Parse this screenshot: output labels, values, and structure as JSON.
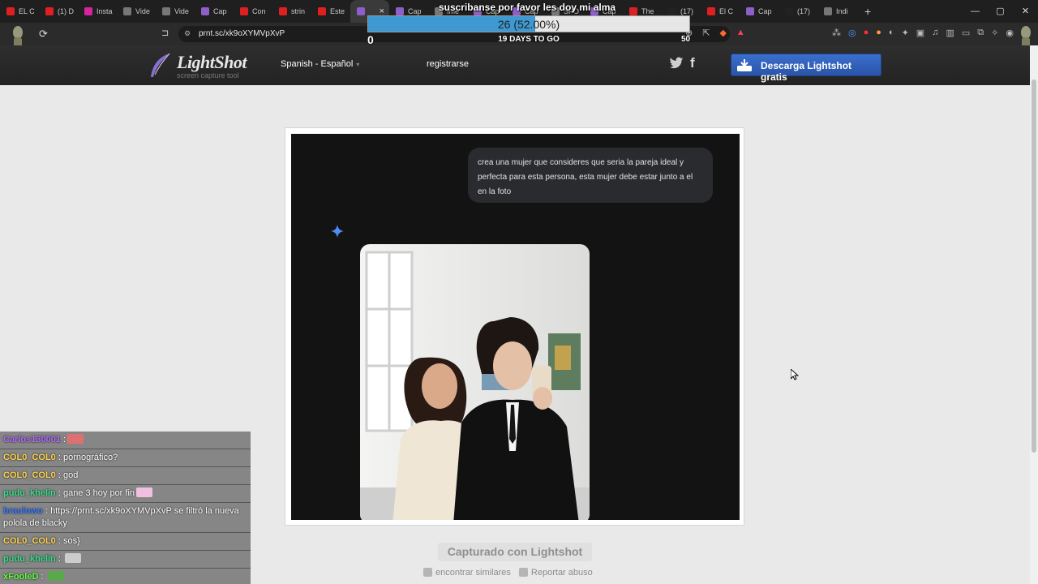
{
  "browser": {
    "tabs": [
      {
        "label": "EL C",
        "color": "#e02020"
      },
      {
        "label": "(1) D",
        "color": "#e02020"
      },
      {
        "label": "Insta",
        "color": "#d6249f"
      },
      {
        "label": "Vide",
        "color": "#777777"
      },
      {
        "label": "Vide",
        "color": "#777777"
      },
      {
        "label": "Cap",
        "color": "#8e5ec9"
      },
      {
        "label": "Con",
        "color": "#e02020"
      },
      {
        "label": "strin",
        "color": "#e02020"
      },
      {
        "label": "Este",
        "color": "#e02020"
      },
      {
        "label": "",
        "color": "#8e5ec9",
        "active": true
      },
      {
        "label": "Cap",
        "color": "#8e5ec9"
      },
      {
        "label": "Ime",
        "color": "#777777"
      },
      {
        "label": "Cap",
        "color": "#8e5ec9"
      },
      {
        "label": "Cap",
        "color": "#8e5ec9"
      },
      {
        "label": "SPO",
        "color": "#777777"
      },
      {
        "label": "Cap",
        "color": "#8e5ec9"
      },
      {
        "label": "The",
        "color": "#e02020"
      },
      {
        "label": "(17)",
        "color": "#222222"
      },
      {
        "label": "El C",
        "color": "#e02020"
      },
      {
        "label": "Cap",
        "color": "#8e5ec9"
      },
      {
        "label": "(17)",
        "color": "#222222"
      },
      {
        "label": "Indi",
        "color": "#777777"
      }
    ],
    "active_tab_close": "×",
    "new_tab": "+",
    "window_controls": {
      "minimize": "—",
      "maximize": "▢",
      "close": "✕"
    },
    "url": "prnt.sc/xk9oXYMVpXvP",
    "reload_icon": "⟳",
    "bookmark_icon": "⊐"
  },
  "stream_overlay": {
    "goal_title": "suscribanse por favor les doy mi alma",
    "goal_progress_text": "26 (52.00%)",
    "goal_fraction": 0.52,
    "goal_min": "0",
    "goal_days": "19 DAYS TO GO",
    "goal_max": "50"
  },
  "lightshot": {
    "logo_name": "LightShot",
    "logo_sub": "screen capture tool",
    "language": "Spanish - Español",
    "register": "registrarse",
    "download_button": "Descarga Lightshot gratis",
    "caption": "Capturado con Lightshot",
    "find_similar": "encontrar similares",
    "report_abuse": "Reportar abuso",
    "accent": "#2f5fb8"
  },
  "screenshot": {
    "prompt_line1": "crea una mujer que consideres que seria la pareja ideal y",
    "prompt_line2": "perfecta para esta persona, esta mujer debe estar junto a el",
    "prompt_line3": "en la foto"
  },
  "chat": [
    {
      "user": "Carlos130001",
      "user_color": "#b36bff",
      "sep": " :",
      "text": "",
      "sticker": "#e07070"
    },
    {
      "user": "COL0_COL0",
      "user_color": "#ffd34d",
      "sep": " : ",
      "text": "pornográfico?"
    },
    {
      "user": "COL0_COL0",
      "user_color": "#ffd34d",
      "sep": " : ",
      "text": "god"
    },
    {
      "user": "pudu_khelin",
      "user_color": "#38e08a",
      "sep": " : ",
      "text": "gane 3 hoy por fin",
      "sticker": "#f0c0e0"
    },
    {
      "user": "braulowo",
      "user_color": "#3a7bff",
      "sep": " : ",
      "text": "https://prnt.sc/xk9oXYMVpXvP se filtró la nueva pololа de blacky"
    },
    {
      "user": "COL0_COL0",
      "user_color": "#ffd34d",
      "sep": " : ",
      "text": "sos}"
    },
    {
      "user": "pudu_khelin",
      "user_color": "#38e08a",
      "sep": " : ",
      "text": "",
      "sticker": "#cccccc"
    },
    {
      "user": "xFooleD",
      "user_color": "#5cff3c",
      "sep": " : ",
      "text": "",
      "sticker": "#5aa84a"
    }
  ]
}
